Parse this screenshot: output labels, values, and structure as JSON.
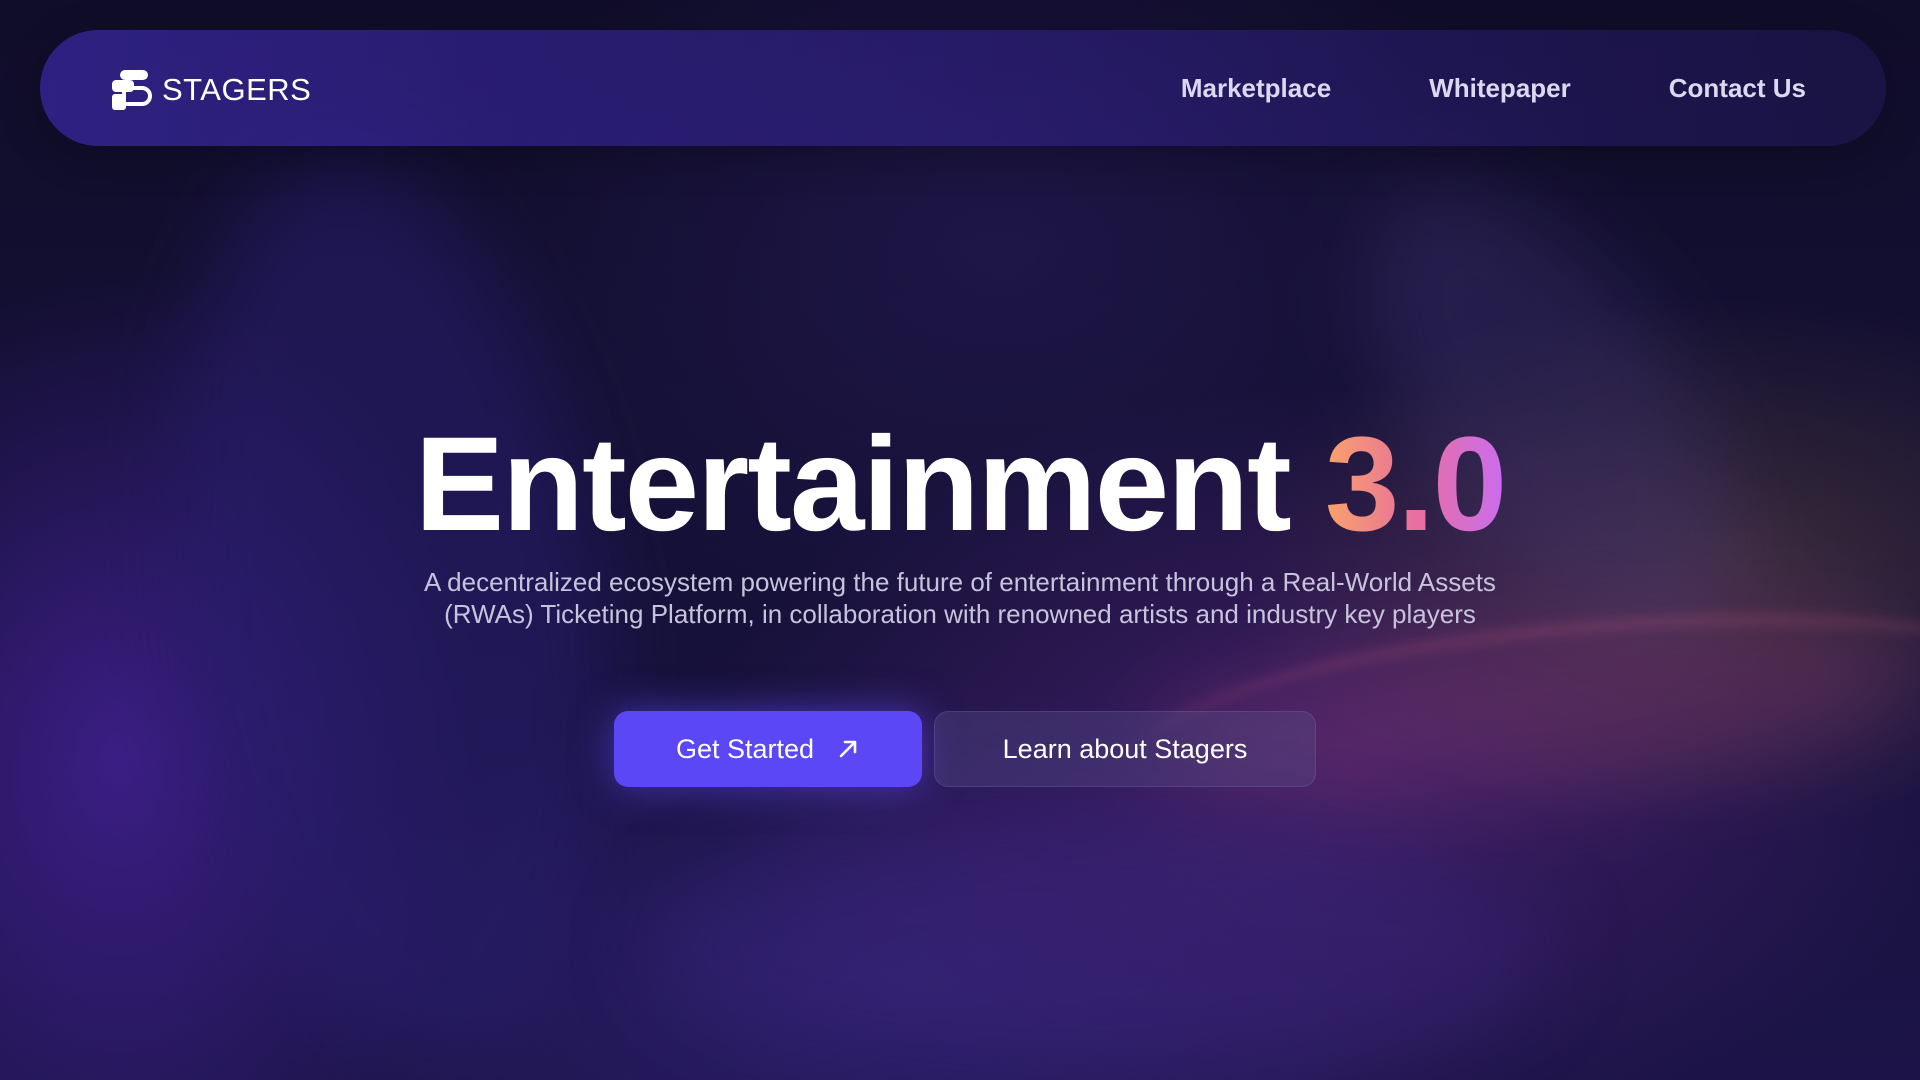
{
  "brand": {
    "name": "STAGERS",
    "logo_icon": "stagers-logo-icon"
  },
  "nav": {
    "links": [
      {
        "label": "Marketplace"
      },
      {
        "label": "Whitepaper"
      },
      {
        "label": "Contact Us"
      }
    ]
  },
  "hero": {
    "title_main": "Entertainment",
    "title_accent": "3.0",
    "subtitle_line1": "A decentralized ecosystem powering the future of entertainment through a Real-World Assets",
    "subtitle_line2": "(RWAs) Ticketing Platform, in collaboration with renowned artists and industry key players"
  },
  "actions": {
    "primary_label": "Get Started",
    "primary_icon": "arrow-up-right-icon",
    "secondary_label": "Learn about Stagers"
  },
  "colors": {
    "primary_button": "#5b47f5",
    "accent_gradient_start": "#f7a36b",
    "accent_gradient_end": "#c96df0"
  }
}
